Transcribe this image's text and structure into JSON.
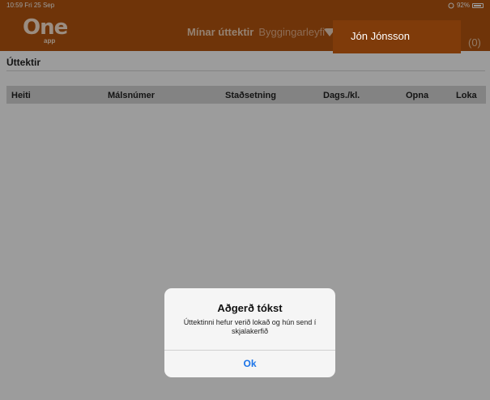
{
  "status_bar": {
    "time": "10:59",
    "date": "Fri 25 Sep",
    "battery": "92%"
  },
  "header": {
    "logo_main": "One",
    "logo_sub": "app",
    "nav_items": [
      {
        "label": "Mínar úttektir",
        "active": true
      },
      {
        "label": "Byggingarleyfi",
        "active": false
      }
    ],
    "user_name": "Jón Jónsson",
    "cart_count": "(0)"
  },
  "page": {
    "title": "Úttektir"
  },
  "table": {
    "columns": [
      "Heiti",
      "Málsnúmer",
      "Staðsetning",
      "Dags./kl.",
      "Opna",
      "Loka"
    ]
  },
  "dialog": {
    "title": "Aðgerð tókst",
    "message": "Úttektinni hefur verið lokað og hún send í skjalakerfið",
    "ok_label": "Ok"
  },
  "colors": {
    "header_bg": "#b5560f",
    "user_bg": "#7f3b0a",
    "accent": "#1a73e8"
  }
}
